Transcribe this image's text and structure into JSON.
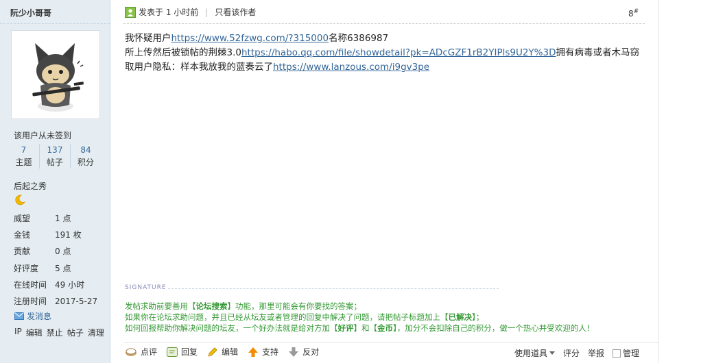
{
  "user": {
    "name": "阮少小哥哥",
    "signin_status": "该用户从未签到",
    "stats": [
      {
        "value": "7",
        "label": "主题"
      },
      {
        "value": "137",
        "label": "帖子"
      },
      {
        "value": "84",
        "label": "积分"
      }
    ],
    "rank": "后起之秀",
    "rank_icon": "crescent-moon-icon",
    "info": [
      {
        "key": "威望",
        "value": "1 点"
      },
      {
        "key": "金钱",
        "value": "191 枚"
      },
      {
        "key": "贡献",
        "value": "0 点"
      },
      {
        "key": "好评度",
        "value": "5 点"
      },
      {
        "key": "在线时间",
        "value": "49 小时"
      },
      {
        "key": "注册时间",
        "value": "2017-5-27"
      }
    ],
    "message_label": "发消息",
    "admin_links": [
      "IP",
      "编辑",
      "禁止",
      "帖子",
      "清理"
    ]
  },
  "post": {
    "posted_at": "发表于 1 小时前",
    "author_only": "只看该作者",
    "floor": "8",
    "floor_mark": "#",
    "content": {
      "l1_text": "我怀疑用户",
      "l1_link": "https://www.52fzwg.com/?315000",
      "l1_tail": "名称6386987",
      "l2_text": "所上传然后被锁帖的荆棘3.0",
      "l2_link": "https://habo.qq.com/file/showdetail?pk=ADcGZF1rB2YIPls9U2Y%3D",
      "l2_tail": "拥有病毒或者木马窃取用户隐私：样本我放我的蓝奏云了",
      "l3_link": "https://www.lanzous.com/i9gv3pe"
    },
    "signature_label": "SIGNATURE",
    "signature": {
      "l1_a": "发帖求助前要善用【",
      "l1_b": "论坛搜索",
      "l1_c": "】功能，那里可能会有你要找的答案；",
      "l2_a": "如果你在论坛求助问题，并且已经从坛友或者管理的回复中解决了问题，请把帖子标题加上【",
      "l2_b": "已解决",
      "l2_c": "】；",
      "l3_a": "如何回报帮助你解决问题的坛友，一个好办法就是给对方加【",
      "l3_b": "好评",
      "l3_c": "】和【",
      "l3_d": "金币",
      "l3_e": "】，加分不会扣除自己的积分，做一个热心并受欢迎的人！"
    },
    "actions": {
      "comment": "点评",
      "reply": "回复",
      "edit": "编辑",
      "support": "支持",
      "oppose": "反对",
      "tools": "使用道具",
      "rate": "评分",
      "report": "举报",
      "manage": "管理"
    }
  },
  "colors": {
    "sidebar_bg": "#e5edf2",
    "link": "#336699",
    "signature": "#339933"
  }
}
